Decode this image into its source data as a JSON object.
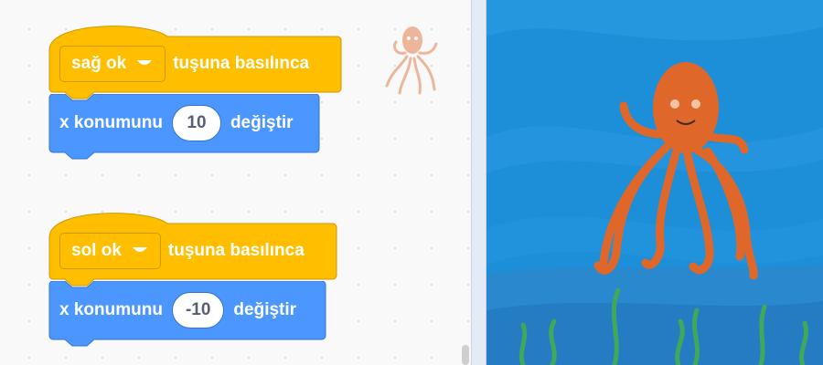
{
  "scripts": [
    {
      "hat": {
        "key": "sağ ok",
        "label": "tuşuna basılınca"
      },
      "motion": {
        "prefix": "x konumunu",
        "value": "10",
        "suffix": "değiştir"
      }
    },
    {
      "hat": {
        "key": "sol ok",
        "label": "tuşuna basılınca"
      },
      "motion": {
        "prefix": "x konumunu",
        "value": "-10",
        "suffix": "değiştir"
      }
    }
  ],
  "colors": {
    "events": "#ffbf00",
    "events_border": "#cc9900",
    "motion": "#4c97ff",
    "motion_border": "#3373cc",
    "stage_water": "#1d8ed8",
    "octopus": "#e0672a",
    "seaweed": "#3fa85a"
  },
  "icons": {
    "sprite": "octopus-sprite-icon",
    "dropdown": "caret-down-icon"
  }
}
